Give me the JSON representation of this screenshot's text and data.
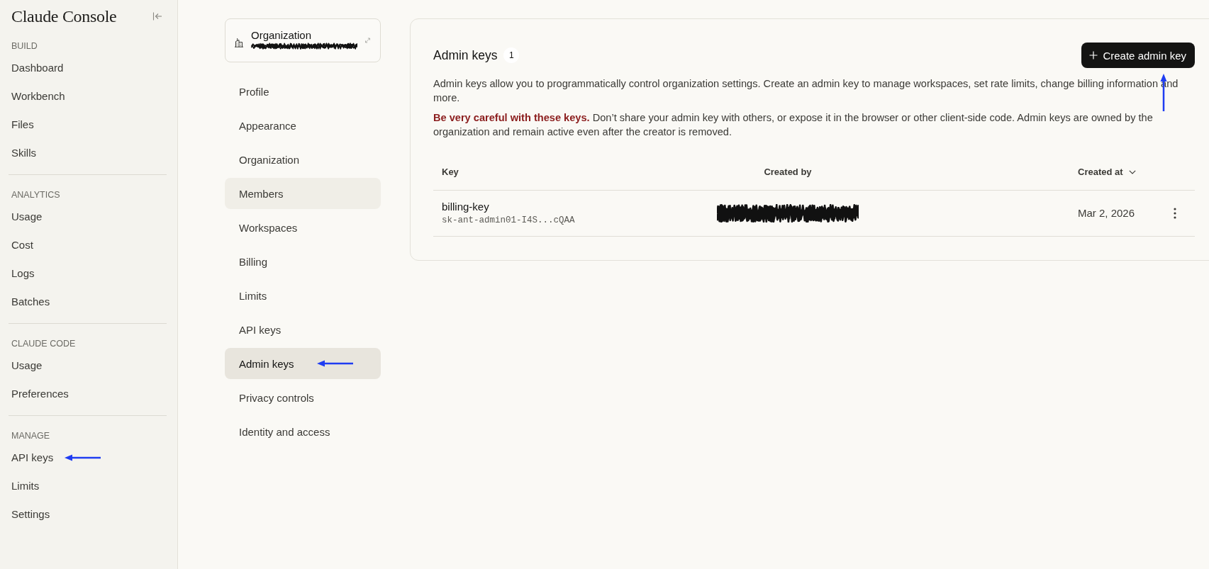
{
  "sidebar": {
    "title": "Claude Console",
    "sections": [
      {
        "heading": "BUILD",
        "items": [
          {
            "label": "Dashboard",
            "pointer_arrow": false
          },
          {
            "label": "Workbench",
            "pointer_arrow": false
          },
          {
            "label": "Files",
            "pointer_arrow": false
          },
          {
            "label": "Skills",
            "pointer_arrow": false
          }
        ]
      },
      {
        "heading": "ANALYTICS",
        "items": [
          {
            "label": "Usage",
            "pointer_arrow": false
          },
          {
            "label": "Cost",
            "pointer_arrow": false
          },
          {
            "label": "Logs",
            "pointer_arrow": false
          },
          {
            "label": "Batches",
            "pointer_arrow": false
          }
        ]
      },
      {
        "heading": "CLAUDE CODE",
        "items": [
          {
            "label": "Usage",
            "pointer_arrow": false
          },
          {
            "label": "Preferences",
            "pointer_arrow": false
          }
        ]
      },
      {
        "heading": "MANAGE",
        "items": [
          {
            "label": "API keys",
            "pointer_arrow": true
          },
          {
            "label": "Limits",
            "pointer_arrow": false
          },
          {
            "label": "Settings",
            "pointer_arrow": false
          }
        ]
      }
    ]
  },
  "settings_nav": {
    "organization": {
      "name": "Organization",
      "subtitle_redacted": true
    },
    "items": [
      {
        "label": "Profile",
        "selected": false,
        "hovered": false,
        "pointer_arrow": false
      },
      {
        "label": "Appearance",
        "selected": false,
        "hovered": false,
        "pointer_arrow": false
      },
      {
        "label": "Organization",
        "selected": false,
        "hovered": false,
        "pointer_arrow": false
      },
      {
        "label": "Members",
        "selected": false,
        "hovered": true,
        "pointer_arrow": false
      },
      {
        "label": "Workspaces",
        "selected": false,
        "hovered": false,
        "pointer_arrow": false
      },
      {
        "label": "Billing",
        "selected": false,
        "hovered": false,
        "pointer_arrow": false
      },
      {
        "label": "Limits",
        "selected": false,
        "hovered": false,
        "pointer_arrow": false
      },
      {
        "label": "API keys",
        "selected": false,
        "hovered": false,
        "pointer_arrow": false
      },
      {
        "label": "Admin keys",
        "selected": true,
        "hovered": false,
        "pointer_arrow": true
      },
      {
        "label": "Privacy controls",
        "selected": false,
        "hovered": false,
        "pointer_arrow": false
      },
      {
        "label": "Identity and access",
        "selected": false,
        "hovered": false,
        "pointer_arrow": false
      }
    ]
  },
  "admin_keys": {
    "title": "Admin keys",
    "count": "1",
    "create_button": {
      "label": "Create admin key",
      "pointer_arrow": true
    },
    "description": "Admin keys allow you to programmatically control organization settings. Create an admin key to manage workspaces, set rate limits, change billing information and more.",
    "warning": "**Be very careful with these keys.** Don’t share your admin key with others, or expose it in the browser or other client-side code. Admin keys are owned by the organization and remain active even after the creator is removed.",
    "table": {
      "columns": [
        {
          "label": "Key",
          "sorted": false
        },
        {
          "label": "Created by",
          "sorted": false
        },
        {
          "label": "Created at",
          "sorted": true
        }
      ],
      "rows": [
        {
          "name": "billing-key",
          "key": "sk-ant-admin01-I4S...cQAA",
          "created_by_redacted": true,
          "created_at": "Mar 2, 2026"
        }
      ]
    }
  }
}
